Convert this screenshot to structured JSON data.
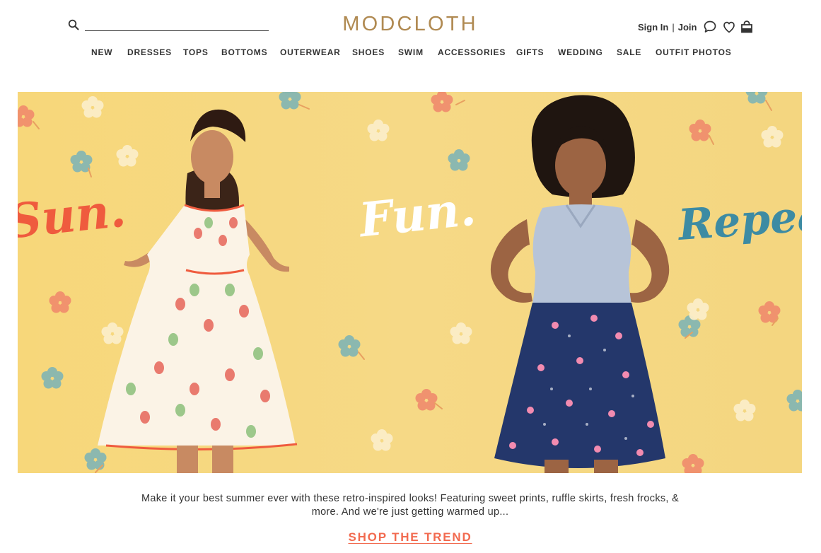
{
  "header": {
    "logo": "MODCLOTH",
    "search": {
      "placeholder": "",
      "value": ""
    },
    "account": {
      "sign_in": "Sign In",
      "separator": "|",
      "join": "Join"
    },
    "icons": [
      "search-icon",
      "chat-icon",
      "heart-icon",
      "bag-icon"
    ]
  },
  "nav": {
    "items": [
      {
        "label": "NEW"
      },
      {
        "label": "DRESSES"
      },
      {
        "label": "TOPS"
      },
      {
        "label": "BOTTOMS"
      },
      {
        "label": "OUTERWEAR"
      },
      {
        "label": "SHOES"
      },
      {
        "label": "SWIM"
      },
      {
        "label": "ACCESSORIES"
      },
      {
        "label": "GIFTS"
      },
      {
        "label": "WEDDING"
      },
      {
        "label": "SALE"
      },
      {
        "label": "OUTFIT PHOTOS"
      }
    ]
  },
  "hero": {
    "words": [
      "Sun.",
      "Fun.",
      "Repeat!"
    ],
    "colors": {
      "background": "#f6d780",
      "sun": "#ef5b3e",
      "fun": "#ffffff",
      "repeat": "#3d8ba3"
    }
  },
  "promo": {
    "blurb": "Make it your best summer ever with these retro-inspired looks! Featuring sweet prints, ruffle skirts, fresh frocks, & more. And we're just getting warmed up...",
    "cta": "SHOP THE TREND",
    "cta_color": "#f26a4f"
  },
  "brand_color": "#b08a52"
}
